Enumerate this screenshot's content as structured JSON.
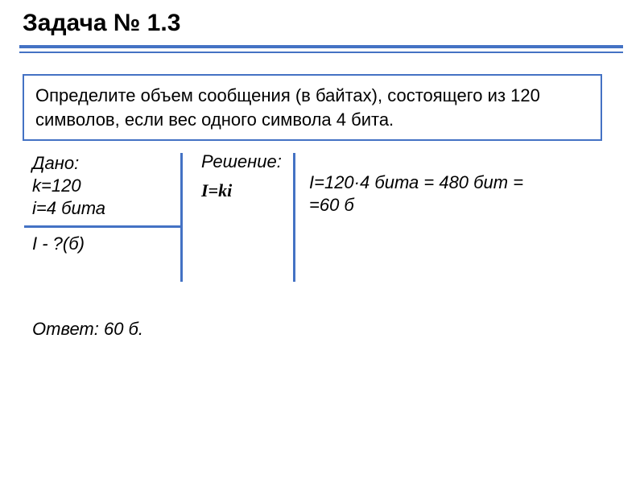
{
  "title": "Задача № 1.3",
  "problem_statement": "Определите объем сообщения (в байтах), состоящего из 120 символов, если вес одного символа 4 бита.",
  "given": {
    "heading": "Дано:",
    "line1": " k=120",
    "line2": "i=4 бита",
    "find": "I - ?(б)"
  },
  "solution": {
    "heading": "Решение:",
    "formula": "I=ki",
    "calc_line1": "I=120·4 бита = 480 бит =",
    "calc_line2": "=60 б"
  },
  "answer": "Ответ: 60 б."
}
